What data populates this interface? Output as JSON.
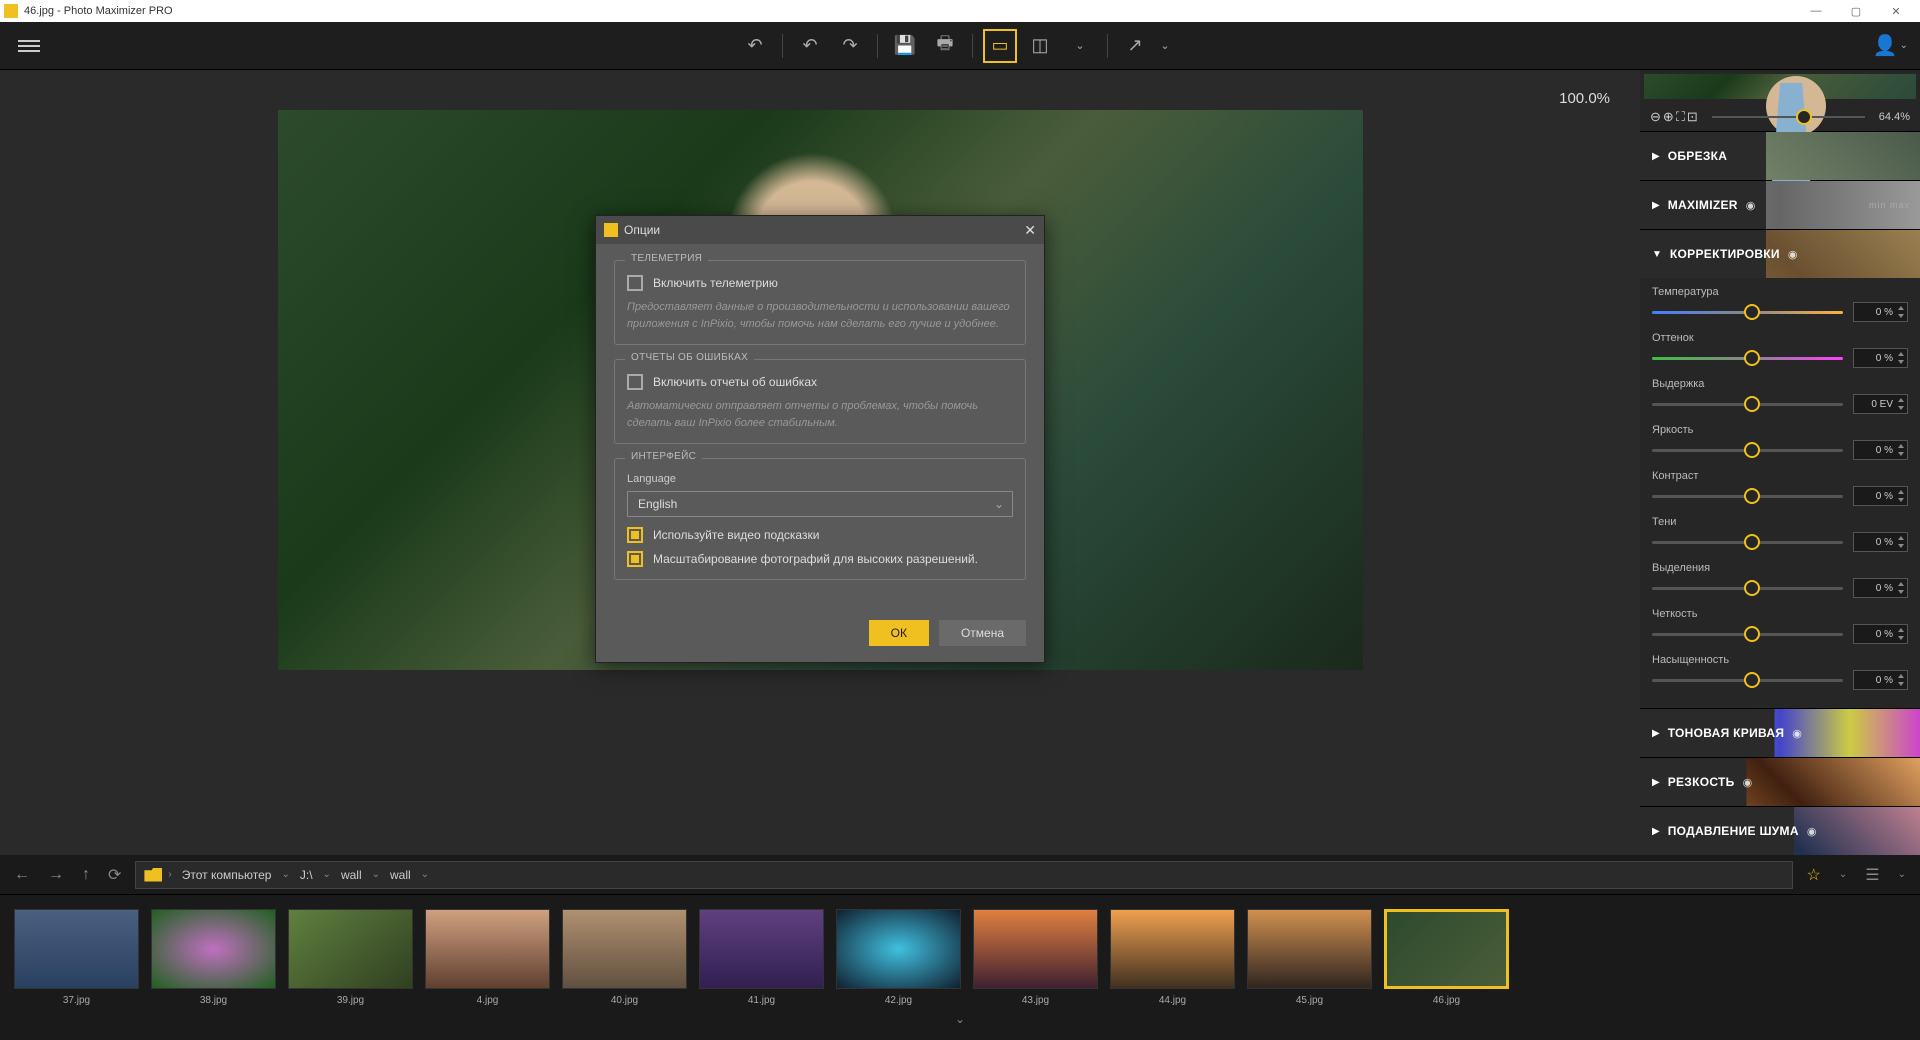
{
  "titlebar": {
    "filename": "46.jpg",
    "app": "Photo Maximizer PRO"
  },
  "canvas": {
    "zoom": "100.0%"
  },
  "preview_zoom": "64.4%",
  "panels": {
    "crop": "ОБРЕЗКА",
    "maximizer": "MAXIMIZER",
    "adjustments": "КОРРЕКТИРОВКИ",
    "tone_curve": "ТОНОВАЯ КРИВАЯ",
    "sharpness": "РЕЗКОСТЬ",
    "noise": "ПОДАВЛЕНИЕ ШУМА"
  },
  "adjustments": [
    {
      "label": "Температура",
      "value": "0 %",
      "cls": "sl-temp"
    },
    {
      "label": "Оттенок",
      "value": "0 %",
      "cls": "sl-tint"
    },
    {
      "label": "Выдержка",
      "value": "0 EV",
      "cls": "sl-gray"
    },
    {
      "label": "Яркость",
      "value": "0 %",
      "cls": "sl-gray"
    },
    {
      "label": "Контраст",
      "value": "0 %",
      "cls": "sl-gray"
    },
    {
      "label": "Тени",
      "value": "0 %",
      "cls": "sl-gray"
    },
    {
      "label": "Выделения",
      "value": "0 %",
      "cls": "sl-gray"
    },
    {
      "label": "Четкость",
      "value": "0 %",
      "cls": "sl-gray"
    },
    {
      "label": "Насыщенность",
      "value": "0 %",
      "cls": "sl-gray"
    }
  ],
  "breadcrumb": {
    "root": "Этот компьютер",
    "drive": "J:\\",
    "folder1": "wall",
    "folder2": "wall"
  },
  "thumbs": [
    {
      "label": "37.jpg",
      "cls": "t37"
    },
    {
      "label": "38.jpg",
      "cls": "t38"
    },
    {
      "label": "39.jpg",
      "cls": "t39"
    },
    {
      "label": "4.jpg",
      "cls": "t4"
    },
    {
      "label": "40.jpg",
      "cls": "t40"
    },
    {
      "label": "41.jpg",
      "cls": "t41"
    },
    {
      "label": "42.jpg",
      "cls": "t42"
    },
    {
      "label": "43.jpg",
      "cls": "t43"
    },
    {
      "label": "44.jpg",
      "cls": "t44"
    },
    {
      "label": "45.jpg",
      "cls": "t45"
    },
    {
      "label": "46.jpg",
      "cls": "t46",
      "selected": true
    }
  ],
  "modal": {
    "title": "Опции",
    "telemetry": {
      "legend": "ТЕЛЕМЕТРИЯ",
      "checkbox": "Включить телеметрию",
      "help": "Предоставляет данные о производительности и использовании вашего приложения с InPixio, чтобы помочь нам сделать его лучше и удобнее."
    },
    "errors": {
      "legend": "ОТЧЕТЫ ОБ ОШИБКАХ",
      "checkbox": "Включить отчеты об ошибках",
      "help": "Автоматически отправляет отчеты о проблемах, чтобы помочь сделать ваш InPixio более стабильным."
    },
    "interface": {
      "legend": "ИНТЕРФЕЙС",
      "language_label": "Language",
      "language_value": "English",
      "hints": "Используйте видео подсказки",
      "scaling": "Масштабирование фотографий для высоких разрешений."
    },
    "ok": "ОК",
    "cancel": "Отмена"
  }
}
